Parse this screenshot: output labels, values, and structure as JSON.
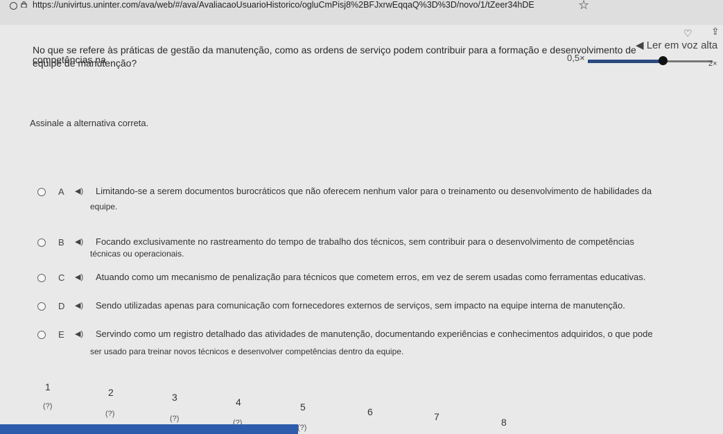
{
  "browser": {
    "url": "https://univirtus.uninter.com/ava/web/#/ava/AvaliacaoUsuarioHistorico/ogluCmPisj8%2BFJxrwEqqaQ%3D%3D/novo/1/tZeer34hDE"
  },
  "tts": {
    "label": "Ler em voz alta",
    "speed_min": "0,5×",
    "speed_max": "2×",
    "speed_level": 0.6
  },
  "question": {
    "line1": "No que se refere às práticas de gestão da manutenção, como as ordens de serviço podem contribuir para a formação e desenvolvimento de competências na",
    "line2": "equipe de manutenção?",
    "instruction": "Assinale a alternativa correta."
  },
  "options": [
    {
      "letter": "A",
      "text": "Limitando-se a serem documentos burocráticos que não oferecem nenhum valor para o treinamento ou desenvolvimento de habilidades da",
      "cont": "equipe."
    },
    {
      "letter": "B",
      "text": "Focando exclusivamente no rastreamento do tempo de trabalho dos técnicos, sem contribuir para o desenvolvimento de competências",
      "cont": "técnicas ou operacionais."
    },
    {
      "letter": "C",
      "text": "Atuando como um mecanismo de penalização para técnicos que cometem erros, em vez de serem usadas como ferramentas educativas.",
      "cont": ""
    },
    {
      "letter": "D",
      "text": "Sendo utilizadas apenas para comunicação com fornecedores externos de serviços, sem impacto na equipe interna de manutenção.",
      "cont": ""
    },
    {
      "letter": "E",
      "text": "Servindo como um registro detalhado das atividades de manutenção, documentando experiências e conhecimentos adquiridos, o que pode",
      "cont": "ser usado para treinar novos técnicos e desenvolver competências dentro da equipe."
    }
  ],
  "nav": [
    {
      "num": "1",
      "status": "(?)"
    },
    {
      "num": "2",
      "status": "(?)"
    },
    {
      "num": "3",
      "status": "(?)"
    },
    {
      "num": "4",
      "status": "(?)"
    },
    {
      "num": "5",
      "status": "(?)"
    },
    {
      "num": "6",
      "status": ""
    },
    {
      "num": "7",
      "status": ""
    },
    {
      "num": "8",
      "status": ""
    }
  ]
}
